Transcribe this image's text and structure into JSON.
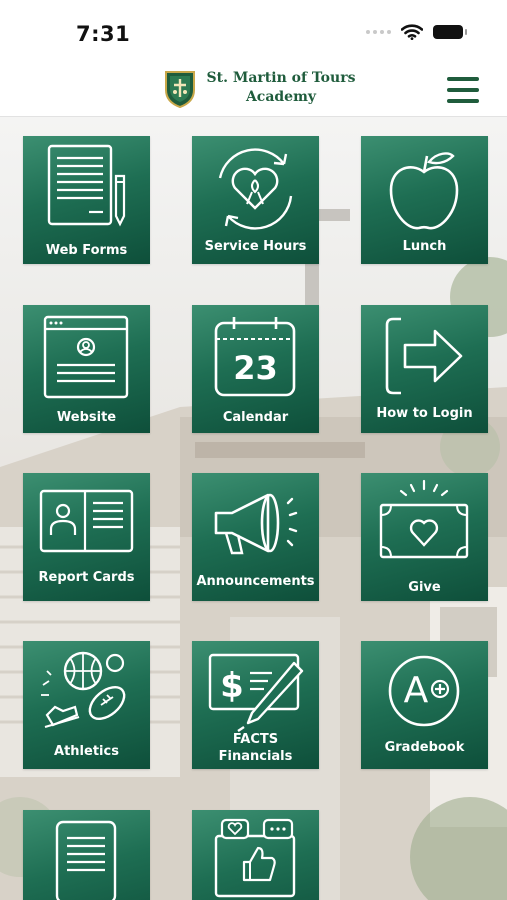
{
  "status_bar": {
    "time": "7:31"
  },
  "header": {
    "school_name_line1": "St. Martin of Tours",
    "school_name_line2": "Academy"
  },
  "colors": {
    "tile_top": "#3c8f71",
    "tile_bottom": "#0e4f3a",
    "brand_green": "#1f5c3c"
  },
  "tiles": [
    {
      "label": "Web Forms",
      "icon": "document-pen-icon"
    },
    {
      "label": "Service Hours",
      "icon": "heart-ribbon-icon"
    },
    {
      "label": "Lunch",
      "icon": "apple-icon"
    },
    {
      "label": "Website",
      "icon": "browser-window-icon"
    },
    {
      "label": "Calendar",
      "icon": "calendar-icon",
      "day": "23"
    },
    {
      "label": "How to Login",
      "icon": "login-arrow-icon"
    },
    {
      "label": "Report Cards",
      "icon": "id-card-icon"
    },
    {
      "label": "Announcements",
      "icon": "megaphone-icon"
    },
    {
      "label": "Give",
      "icon": "heart-banknote-icon"
    },
    {
      "label": "Athletics",
      "icon": "sports-balls-icon"
    },
    {
      "label": "FACTS",
      "label_line2": "Financials",
      "icon": "dollar-check-icon"
    },
    {
      "label": "Gradebook",
      "icon": "a-plus-grade-icon",
      "grade": "A"
    },
    {
      "label": "",
      "icon": "tablet-document-icon"
    },
    {
      "label": "",
      "icon": "social-media-icon"
    }
  ]
}
